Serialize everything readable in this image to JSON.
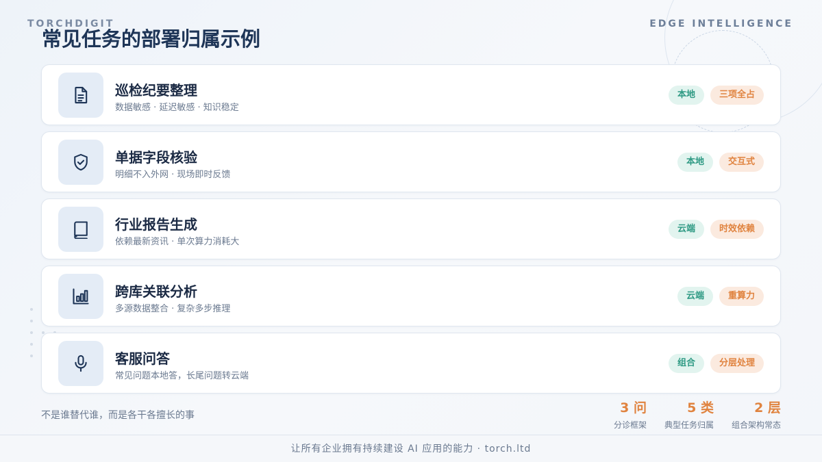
{
  "header": {
    "brand_left": "TORCHDIGIT",
    "brand_right": "EDGE INTELLIGENCE",
    "title": "常见任务的部署归属示例"
  },
  "cards": [
    {
      "icon": "document-icon",
      "title": "巡检纪要整理",
      "subtitle": "数据敏感 · 延迟敏感 · 知识稳定",
      "tag1": "本地",
      "tag2": "三项全占"
    },
    {
      "icon": "shield-check-icon",
      "title": "单据字段核验",
      "subtitle": "明细不入外网 · 现场即时反馈",
      "tag1": "本地",
      "tag2": "交互式"
    },
    {
      "icon": "book-icon",
      "title": "行业报告生成",
      "subtitle": "依赖最新资讯 · 单次算力消耗大",
      "tag1": "云端",
      "tag2": "时效依赖"
    },
    {
      "icon": "bar-chart-icon",
      "title": "跨库关联分析",
      "subtitle": "多源数据整合 · 复杂多步推理",
      "tag1": "云端",
      "tag2": "重算力"
    },
    {
      "icon": "microphone-icon",
      "title": "客服问答",
      "subtitle": "常见问题本地答，长尾问题转云端",
      "tag1": "组合",
      "tag2": "分层处理"
    }
  ],
  "footnote": "不是谁替代谁，而是各干各擅长的事",
  "stats": [
    {
      "num": "3 问",
      "label": "分诊框架"
    },
    {
      "num": "5 类",
      "label": "典型任务归属"
    },
    {
      "num": "2 层",
      "label": "组合架构常态"
    }
  ],
  "footer": "让所有企业拥有持续建设 AI 应用的能力 · torch.ltd",
  "colors": {
    "accent_orange": "#e0833f",
    "accent_green": "#2f9a84",
    "title_navy": "#1e3557"
  }
}
